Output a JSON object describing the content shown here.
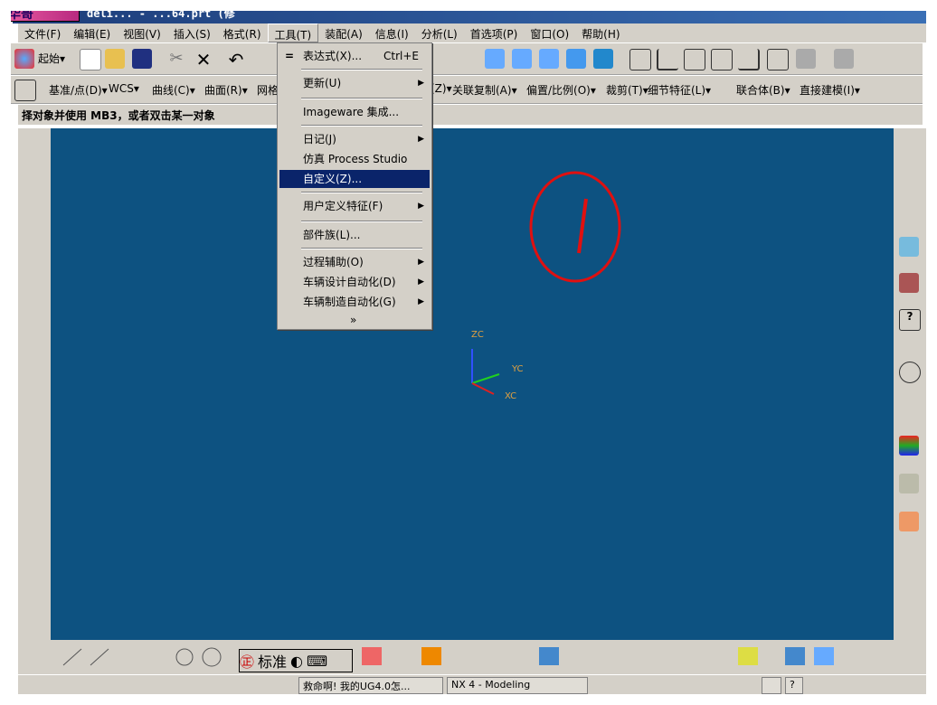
{
  "title": {
    "badge": "华哥",
    "text": "deli... - ...64.prt (修"
  },
  "menubar": [
    "文件(F)",
    "编辑(E)",
    "视图(V)",
    "插入(S)",
    "格式(R)",
    "工具(T)",
    "装配(A)",
    "信息(I)",
    "分析(L)",
    "首选项(P)",
    "窗口(O)",
    "帮助(H)"
  ],
  "toolbar1": {
    "start": "起始▾"
  },
  "toolbar2": [
    "基准/点(D)▾",
    "WCS▾",
    "曲线(C)▾",
    "曲面(R)▾",
    "网格",
    "(Z)▾",
    "关联复制(A)▾",
    "偏置/比例(O)▾",
    "裁剪(T)▾",
    "细节特征(L)▾",
    "联合体(B)▾",
    "直接建模(I)▾"
  ],
  "status": "择对象并使用 MB3，或者双击某一对象",
  "dropdown": {
    "items": [
      {
        "label": "表达式(X)...",
        "shortcut": "Ctrl+E"
      },
      {
        "label": "更新(U)"
      },
      {
        "label": "Imageware 集成..."
      },
      {
        "label": "日记(J)"
      },
      {
        "label": "仿真 Process Studio"
      },
      {
        "label": "自定义(Z)..."
      },
      {
        "label": "用户定义特征(F)"
      },
      {
        "label": "部件族(L)..."
      },
      {
        "label": "过程辅助(O)"
      },
      {
        "label": "车辆设计自动化(D)"
      },
      {
        "label": "车辆制造自动化(G)"
      }
    ],
    "more": "»"
  },
  "annotation": "/",
  "axes": {
    "z": "ZC",
    "y": "YC",
    "x": "XC"
  },
  "ime": {
    "label": "标准"
  },
  "taskbar": [
    "救命啊! 我的UG4.0怎...",
    "NX 4 - Modeling"
  ],
  "colors": {
    "viewport": "#0d5281",
    "selected": "#0a246a",
    "annotation": "#e01010"
  }
}
